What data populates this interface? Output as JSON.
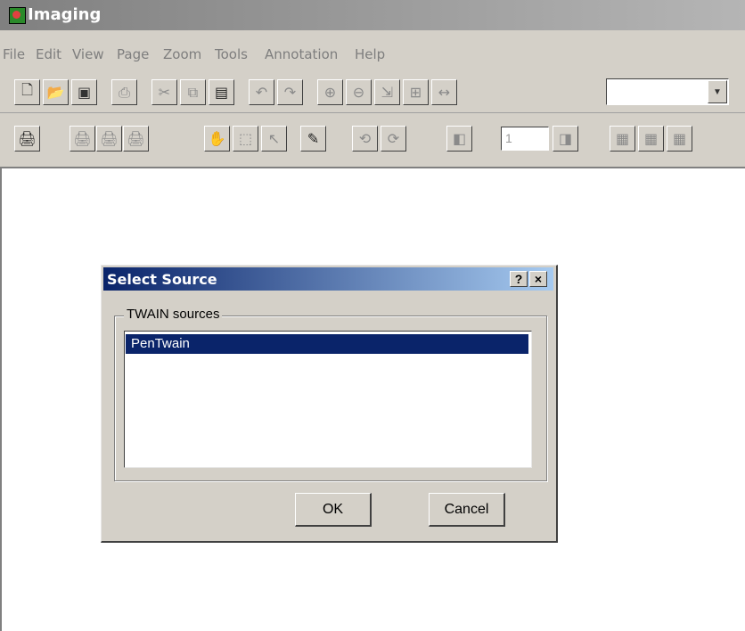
{
  "app": {
    "title": "Imaging"
  },
  "menu": [
    "File",
    "Edit",
    "View",
    "Page",
    "Zoom",
    "Tools",
    "Annotation",
    "Help"
  ],
  "toolbar": {
    "zoom_value": "",
    "page_number": "1"
  },
  "dialog": {
    "title": "Select Source",
    "help_glyph": "?",
    "close_glyph": "×",
    "group_label": "TWAIN sources",
    "sources": [
      "PenTwain"
    ],
    "selected_source": "PenTwain",
    "ok_label": "OK",
    "cancel_label": "Cancel"
  },
  "icons": {
    "tb1": [
      "new-icon",
      "open-icon",
      "save-icon",
      "print-icon",
      "cut-icon",
      "copy-icon",
      "paste-icon",
      "undo-icon",
      "redo-icon",
      "zoom-in-icon",
      "zoom-out-icon",
      "zoom-to-fit-icon",
      "best-fit-icon",
      "fit-width-icon"
    ],
    "tb2": [
      "scan-icon",
      "scan-new-icon",
      "scan-insert-icon",
      "scan-append-icon",
      "drag-hand-icon",
      "select-image-icon",
      "select-annotation-icon",
      "annotation-toolbar-icon",
      "rotate-left-icon",
      "rotate-right-icon",
      "previous-page-icon",
      "next-page-icon",
      "one-page-view-icon",
      "thumbnail-view-icon",
      "page-thumbnail-view-icon"
    ]
  },
  "colors": {
    "title_bar": "#808080",
    "dialog_title_start": "#0a246a",
    "dialog_title_end": "#a6caf0",
    "selection": "#0a246a",
    "face": "#d4d0c8"
  }
}
